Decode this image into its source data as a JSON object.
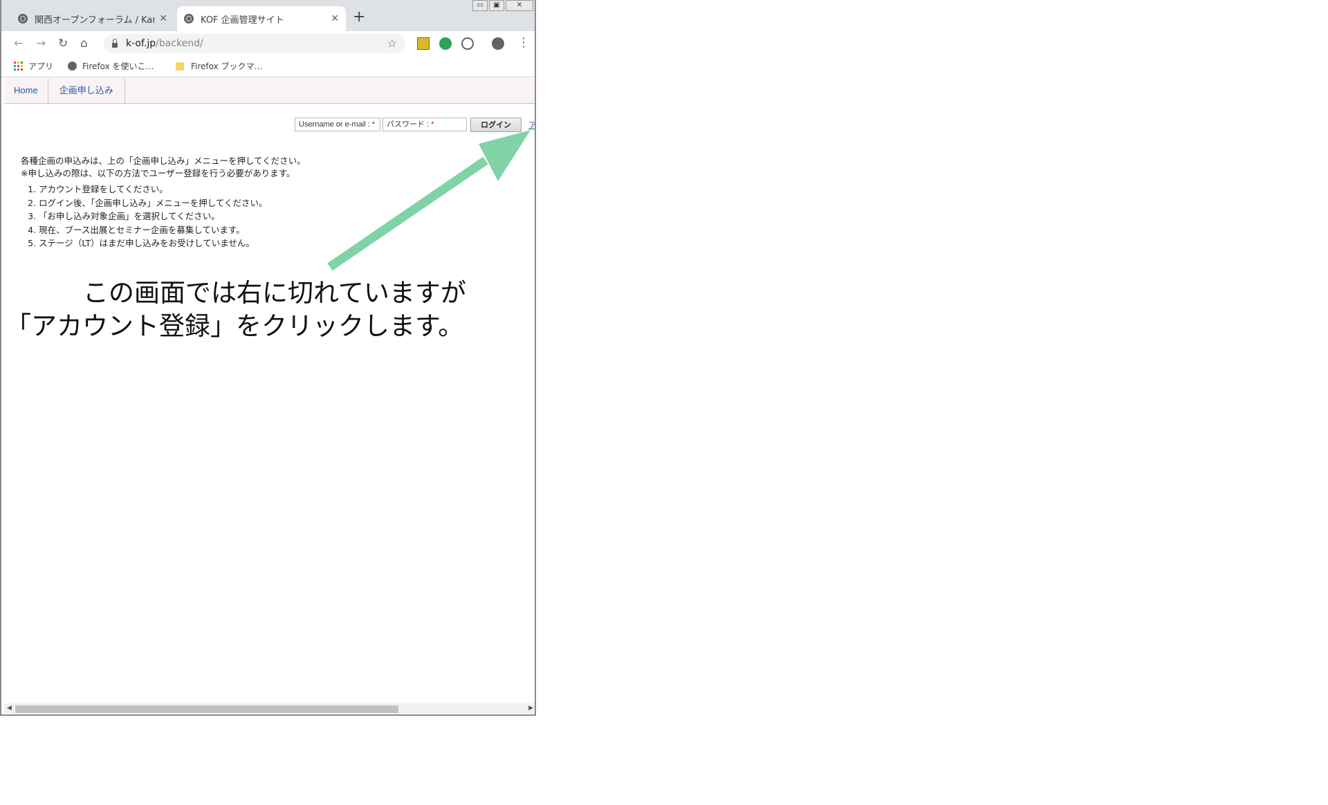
{
  "browser": {
    "tabs": [
      {
        "title": "関西オープンフォーラム / Kans",
        "active": false
      },
      {
        "title": "KOF 企画管理サイト",
        "active": true
      }
    ],
    "url": {
      "host": "k-of.jp",
      "path": "/backend/"
    },
    "bookmarks": [
      {
        "label": "アプリ",
        "icon": "apps-grid-icon"
      },
      {
        "label": "Firefox を使いこ…",
        "icon": "globe-icon"
      },
      {
        "label": "Firefox ブックマ…",
        "icon": "folder-icon"
      }
    ],
    "window_controls": {
      "minimize": "▭",
      "restore": "▣",
      "close": "✕"
    }
  },
  "site": {
    "nav": [
      {
        "label": "Home"
      },
      {
        "label": "企画申し込み"
      }
    ],
    "login": {
      "username_label": "Username or e-mail :",
      "password_label": "パスワード :",
      "required_mark": "*",
      "login_button": "ログイン",
      "register_link": "ア"
    },
    "intro": [
      "各種企画の申込みは、上の「企画申し込み」メニューを押してください。",
      "※申し込みの際は、以下の方法でユーザー登録を行う必要があります。"
    ],
    "steps": [
      "アカウント登録をしてください。",
      "ログイン後、「企画申し込み」メニューを押してください。",
      "「お申し込み対象企画」を選択してください。",
      "現在、ブース出展とセミナー企画を募集しています。",
      "ステージ（LT）はまだ申し込みをお受けしていません。"
    ]
  },
  "annotation": {
    "line1": "この画面では右に切れていますが",
    "line2": "「アカウント登録」をクリックします。",
    "arrow_color": "#7fd3a6"
  }
}
